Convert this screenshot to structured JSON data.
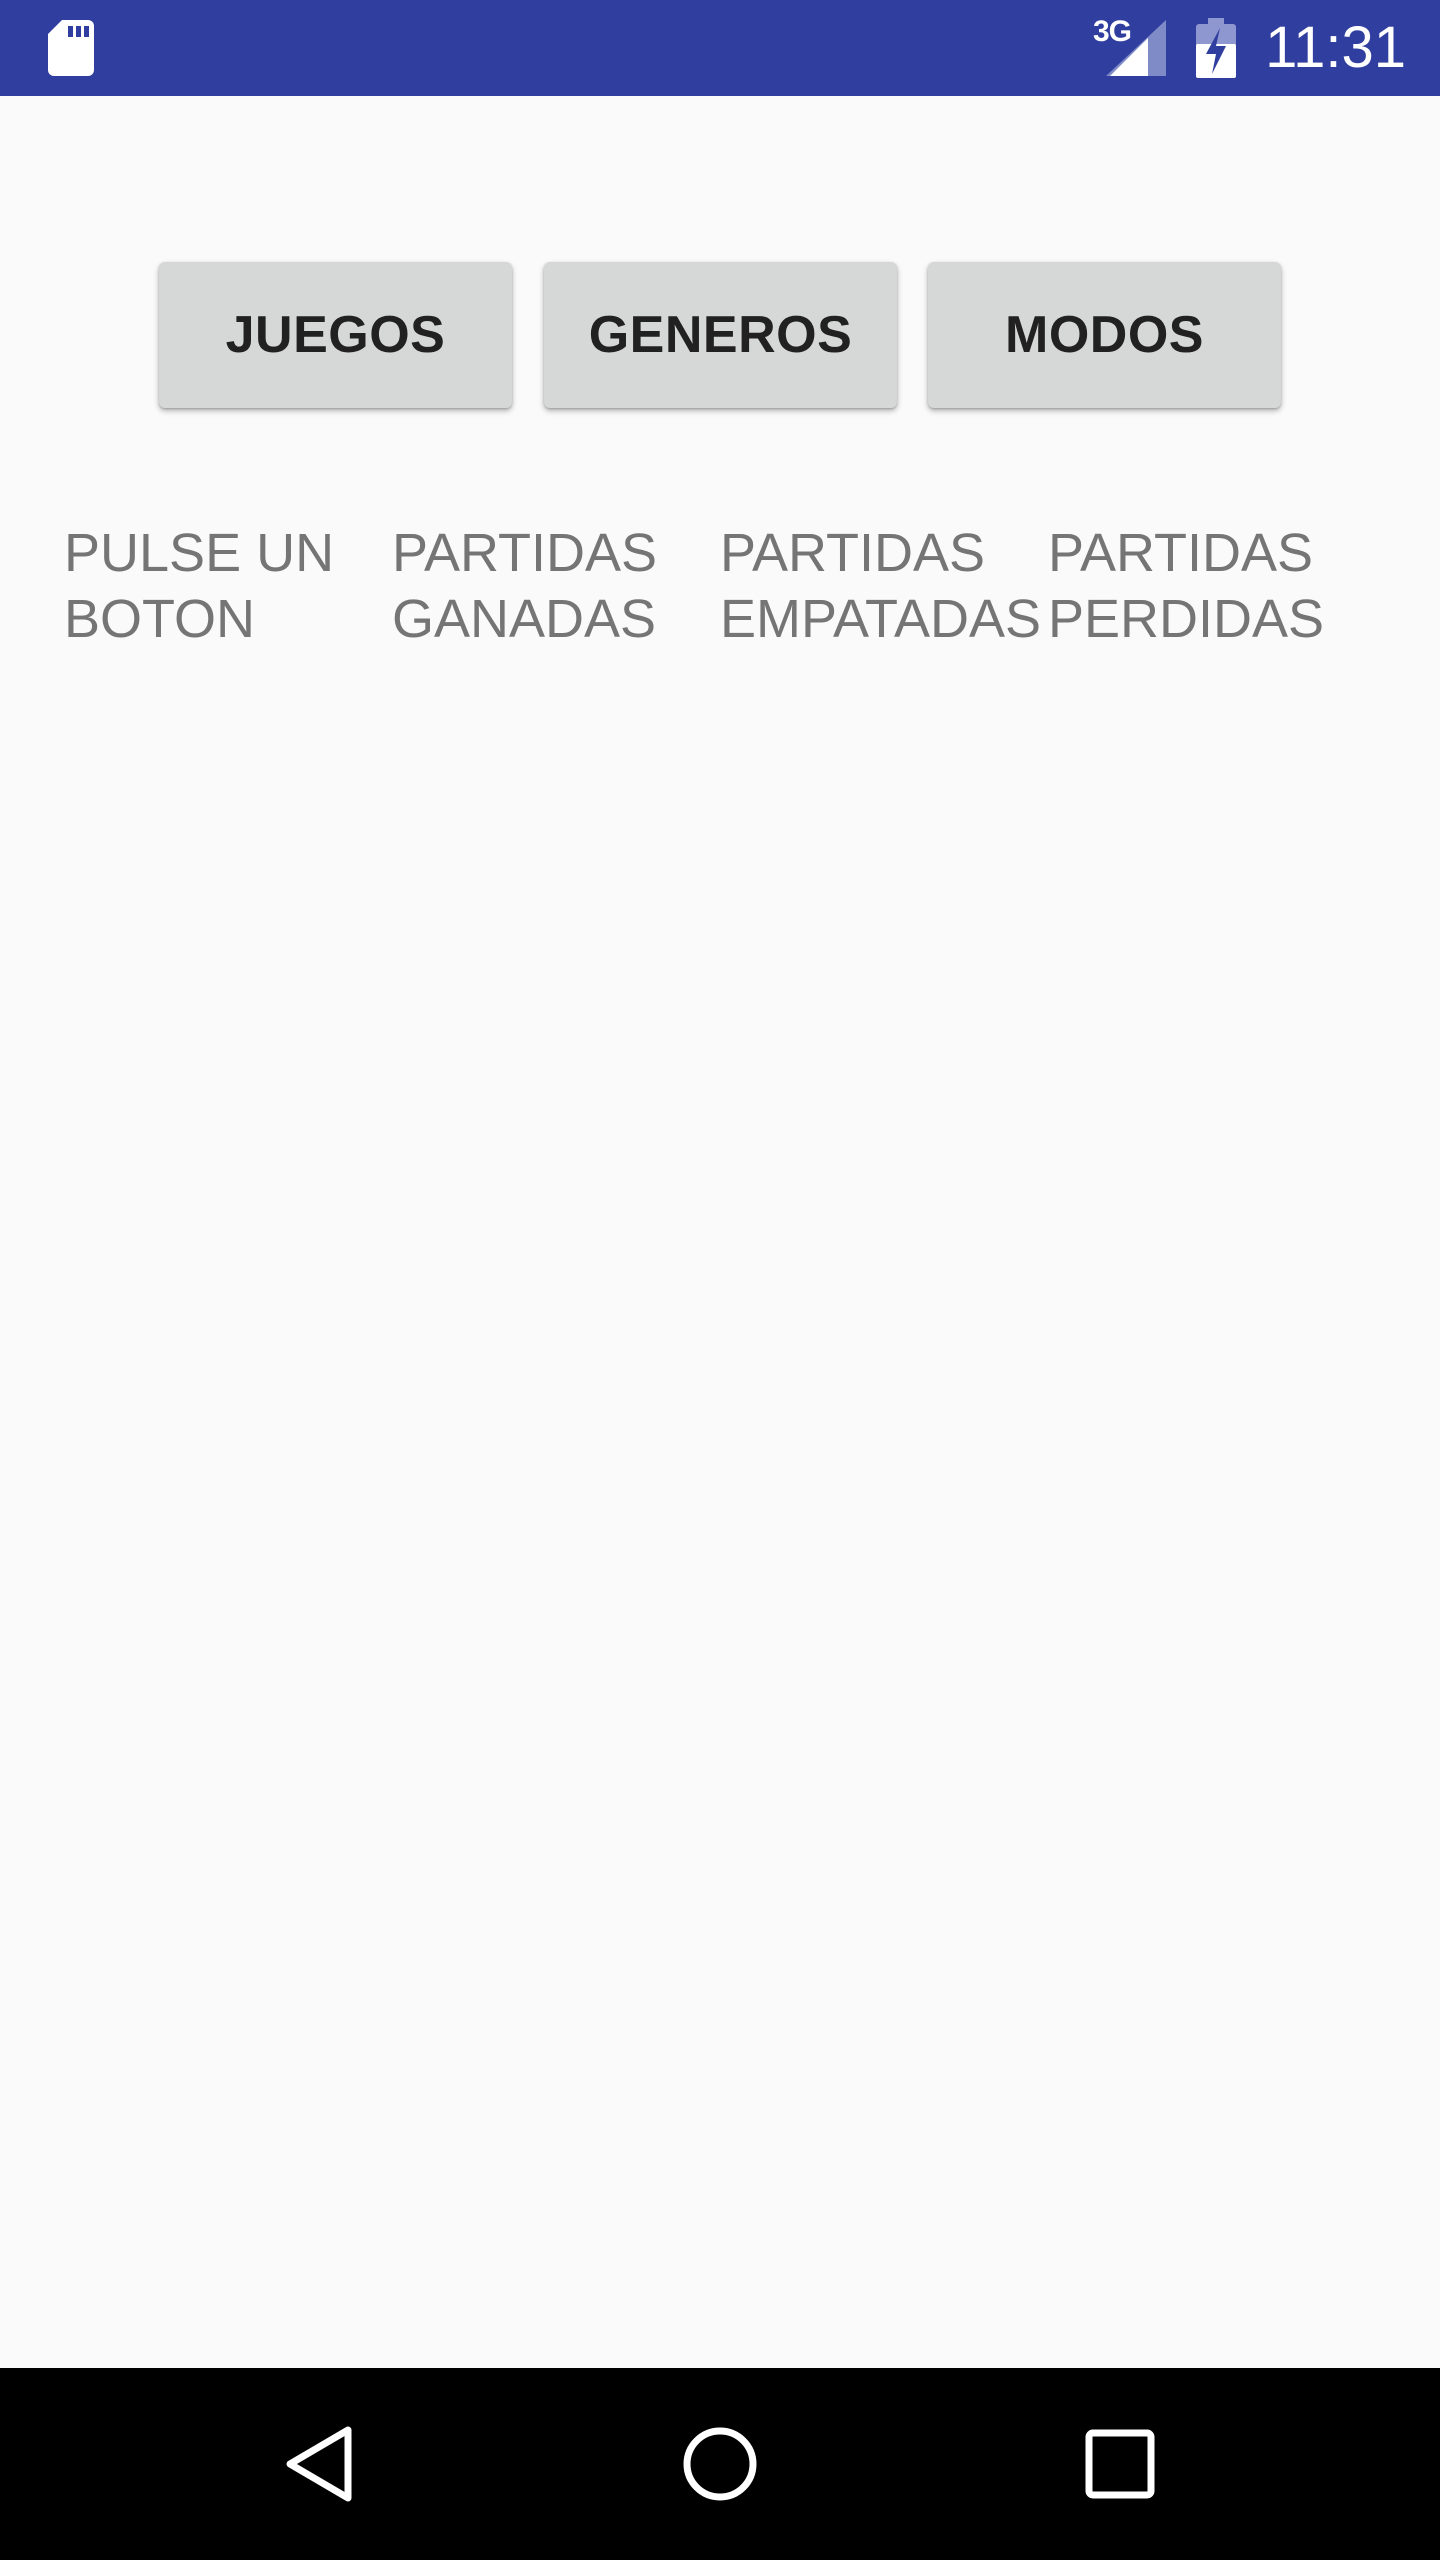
{
  "status_bar": {
    "network_label": "3G",
    "time": "11:31",
    "background_color": "#303f9f",
    "icons": [
      "sd-card-icon",
      "signal-icon",
      "battery-charging-icon"
    ]
  },
  "buttons": {
    "juegos": "JUEGOS",
    "generos": "GENEROS",
    "modos": "MODOS"
  },
  "stats": {
    "prompt": "PULSE UN\nBOTON",
    "won": "PARTIDAS\nGANADAS",
    "tied": "PARTIDAS\nEMPATADAS",
    "lost": "PARTIDAS\nPERDIDAS"
  },
  "nav_bar": {
    "icons": [
      "back-icon",
      "home-icon",
      "recents-icon"
    ]
  }
}
